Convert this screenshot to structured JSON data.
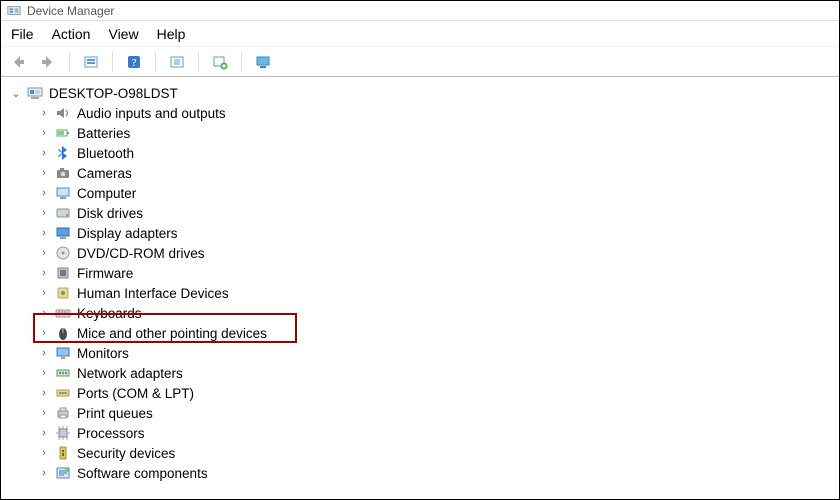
{
  "window": {
    "title": "Device Manager"
  },
  "menu": {
    "file": "File",
    "action": "Action",
    "view": "View",
    "help": "Help"
  },
  "toolbar": {
    "back": "back",
    "forward": "forward",
    "show_hidden": "show-hidden",
    "help": "help",
    "scan": "scan-hardware",
    "add": "add-legacy",
    "remote": "remote-computer"
  },
  "tree": {
    "root": {
      "label": "DESKTOP-O98LDST",
      "expanded": true
    },
    "nodes": [
      {
        "label": "Audio inputs and outputs",
        "icon": "speaker-icon"
      },
      {
        "label": "Batteries",
        "icon": "battery-icon"
      },
      {
        "label": "Bluetooth",
        "icon": "bluetooth-icon"
      },
      {
        "label": "Cameras",
        "icon": "camera-icon"
      },
      {
        "label": "Computer",
        "icon": "computer-icon"
      },
      {
        "label": "Disk drives",
        "icon": "disk-icon"
      },
      {
        "label": "Display adapters",
        "icon": "display-icon"
      },
      {
        "label": "DVD/CD-ROM drives",
        "icon": "cdrom-icon"
      },
      {
        "label": "Firmware",
        "icon": "firmware-icon"
      },
      {
        "label": "Human Interface Devices",
        "icon": "hid-icon"
      },
      {
        "label": "Keyboards",
        "icon": "keyboard-icon"
      },
      {
        "label": "Mice and other pointing devices",
        "icon": "mouse-icon",
        "highlighted": true
      },
      {
        "label": "Monitors",
        "icon": "monitor-icon"
      },
      {
        "label": "Network adapters",
        "icon": "network-icon"
      },
      {
        "label": "Ports (COM & LPT)",
        "icon": "port-icon"
      },
      {
        "label": "Print queues",
        "icon": "printer-icon"
      },
      {
        "label": "Processors",
        "icon": "processor-icon"
      },
      {
        "label": "Security devices",
        "icon": "security-icon"
      },
      {
        "label": "Software components",
        "icon": "software-icon"
      }
    ]
  },
  "annotation": {
    "highlight_color": "#a00000"
  }
}
